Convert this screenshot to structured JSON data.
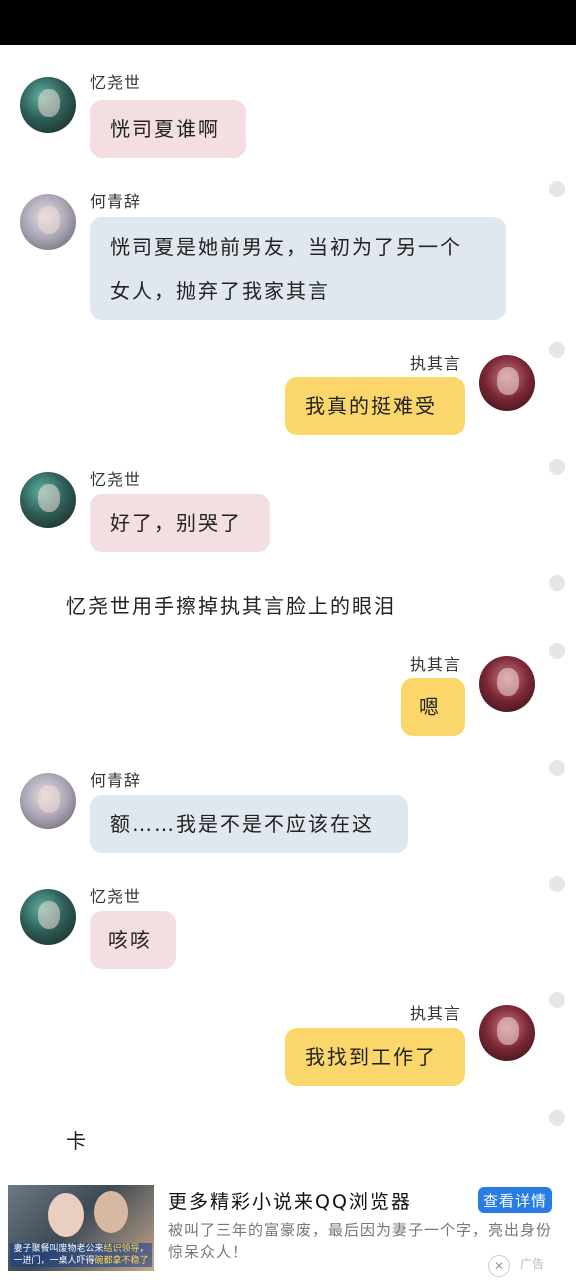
{
  "messages": [
    {
      "sender": "忆尧世",
      "text": "恍司夏谁啊"
    },
    {
      "sender": "何青辞",
      "line1": "恍司夏是她前男友，当初为了另一个",
      "line2": "女人，抛弃了我家其言"
    },
    {
      "sender": "执其言",
      "text": "我真的挺难受"
    },
    {
      "sender": "忆尧世",
      "text": "好了，别哭了"
    },
    {
      "narration": "忆尧世用手擦掉执其言脸上的眼泪"
    },
    {
      "sender": "执其言",
      "text": "嗯"
    },
    {
      "sender": "何青辞",
      "text": "额……我是不是不应该在这"
    },
    {
      "sender": "忆尧世",
      "text": "咳咳"
    },
    {
      "sender": "执其言",
      "text": "我找到工作了"
    },
    {
      "narration": "卡"
    }
  ],
  "ad": {
    "title": "更多精彩小说来QQ浏览器",
    "button": "查看详情",
    "description": "被叫了三年的富豪废，最后因为妻子一个字，亮出身份惊呆众人！",
    "thumb_caption_part1": "妻子聚餐叫废物老公来",
    "thumb_caption_highlight": "结识领导",
    "thumb_caption_part2": "，一进门，一桌人吓得",
    "thumb_caption_highlight2": "碗都拿不稳了",
    "close_symbol": "✕",
    "label": "广告"
  },
  "colors": {
    "bubble_pink": "#f3dfe1",
    "bubble_blue": "#e1e7ef",
    "bubble_yellow": "#fbd76b",
    "ad_button": "#2a7de0"
  },
  "icons": [
    "avatar-yiyaoshi",
    "avatar-heqingci",
    "avatar-zhiqiyan",
    "close-icon"
  ]
}
